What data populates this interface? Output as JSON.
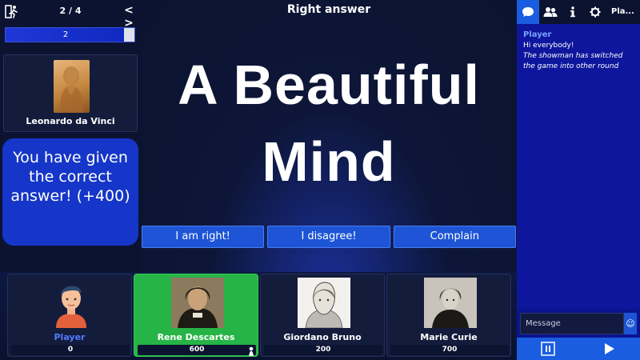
{
  "topbar": {
    "exit_icon": "exit-run-icon",
    "round_counter": "2 / 4",
    "nav_icon": "< >"
  },
  "progress": {
    "label": "2",
    "fraction": 0.92
  },
  "author": {
    "name": "Leonardo da Vinci"
  },
  "feedback": {
    "text": "You have given the correct answer! (+400)"
  },
  "question": {
    "header": "Right answer",
    "text": "A Beautiful Mind"
  },
  "actions": {
    "right": "I am right!",
    "disagree": "I disagree!",
    "complain": "Complain"
  },
  "players": [
    {
      "name": "Player",
      "score": "0",
      "self": true,
      "active": false
    },
    {
      "name": "Rene Descartes",
      "score": "600",
      "self": false,
      "active": true
    },
    {
      "name": "Giordano Bruno",
      "score": "200",
      "self": false,
      "active": false
    },
    {
      "name": "Marie Curie",
      "score": "700",
      "self": false,
      "active": false
    }
  ],
  "chat": {
    "tabs": [
      "chat-icon",
      "players-icon",
      "info-icon",
      "gear-icon"
    ],
    "tab_label": "Pla...",
    "messages": [
      {
        "author": "Player",
        "text": "Hi everybody!"
      }
    ],
    "system_message": "The showman has switched the game into other round",
    "input_placeholder": "Message",
    "emoji_icon": "☺"
  },
  "colors": {
    "accent": "#1d55d6",
    "active_player": "#27b446",
    "chat_bg": "#0d169c",
    "background": "#0c1330"
  }
}
